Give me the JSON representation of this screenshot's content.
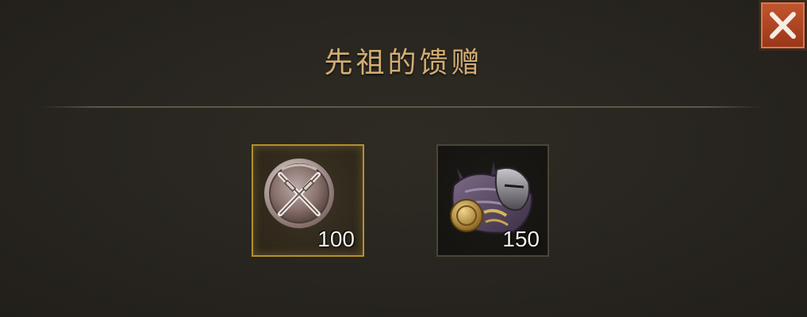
{
  "dialog": {
    "title": "先祖的馈赠",
    "close_icon": "close-x-icon"
  },
  "rewards": [
    {
      "icon": "crossed-swords-medal-icon",
      "quantity": "100",
      "selected": true
    },
    {
      "icon": "dark-armor-helmet-icon",
      "quantity": "150",
      "selected": false
    }
  ],
  "colors": {
    "title": "#d2ad72",
    "close_button": "#b2431f",
    "selected_border": "#b5902c",
    "background": "#2a2620"
  }
}
